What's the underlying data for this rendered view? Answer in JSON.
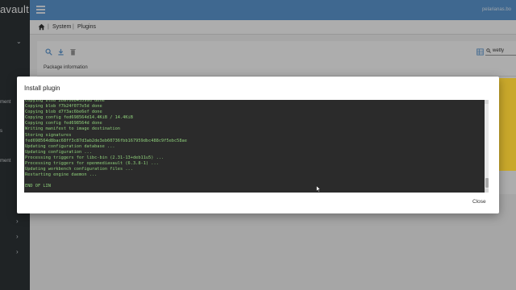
{
  "app": {
    "brand": "avault",
    "hostname": "pelarianas.bo"
  },
  "sidebar": {
    "items": [
      {
        "label": "ment"
      },
      {
        "label": "s"
      },
      {
        "label": "ment"
      }
    ]
  },
  "breadcrumb": {
    "items": [
      "System",
      "Plugins"
    ]
  },
  "panel": {
    "search_value": "wetty",
    "column_header": "Package information"
  },
  "dialog": {
    "title": "Install plugin",
    "console_lines": [
      "Copying blob 2baf06845599d done",
      "Copying blob f7b24f077e5d done",
      "Copying blob d7f3ac6be6ef done",
      "Copying config fed698564d14.4KiB / 14.4KiB",
      "Copying config fed698564d done",
      "Writing manifest to image destination",
      "Storing signatures",
      "fed698564d8bac68ff3c87d3ab2de3eb60736fbb167959dbc488c9f5ebc58ae",
      "Updating configuration database ...",
      "Updating configuration ...",
      "Processing triggers for libc-bin (2.31-13+deb11u5) ...",
      "Processing triggers for openmediavault (6.3.8-1) ...",
      "Updating workbench configuration files ...",
      "Restarting engine daemon ...",
      "",
      "END OF LIN"
    ],
    "close_label": "Close"
  },
  "colors": {
    "topbar": "#5d9ad4",
    "sidebar": "#2f3437",
    "console_bg": "#2b2b2b",
    "console_text": "#8fd07b",
    "accent_yellow": "#c9a82b"
  },
  "icons": [
    "menu-icon",
    "home-icon",
    "search-icon",
    "download-icon",
    "trash-icon",
    "grid-view-icon",
    "chevron-down-icon",
    "chevron-right-icon",
    "mouse-cursor-icon"
  ]
}
